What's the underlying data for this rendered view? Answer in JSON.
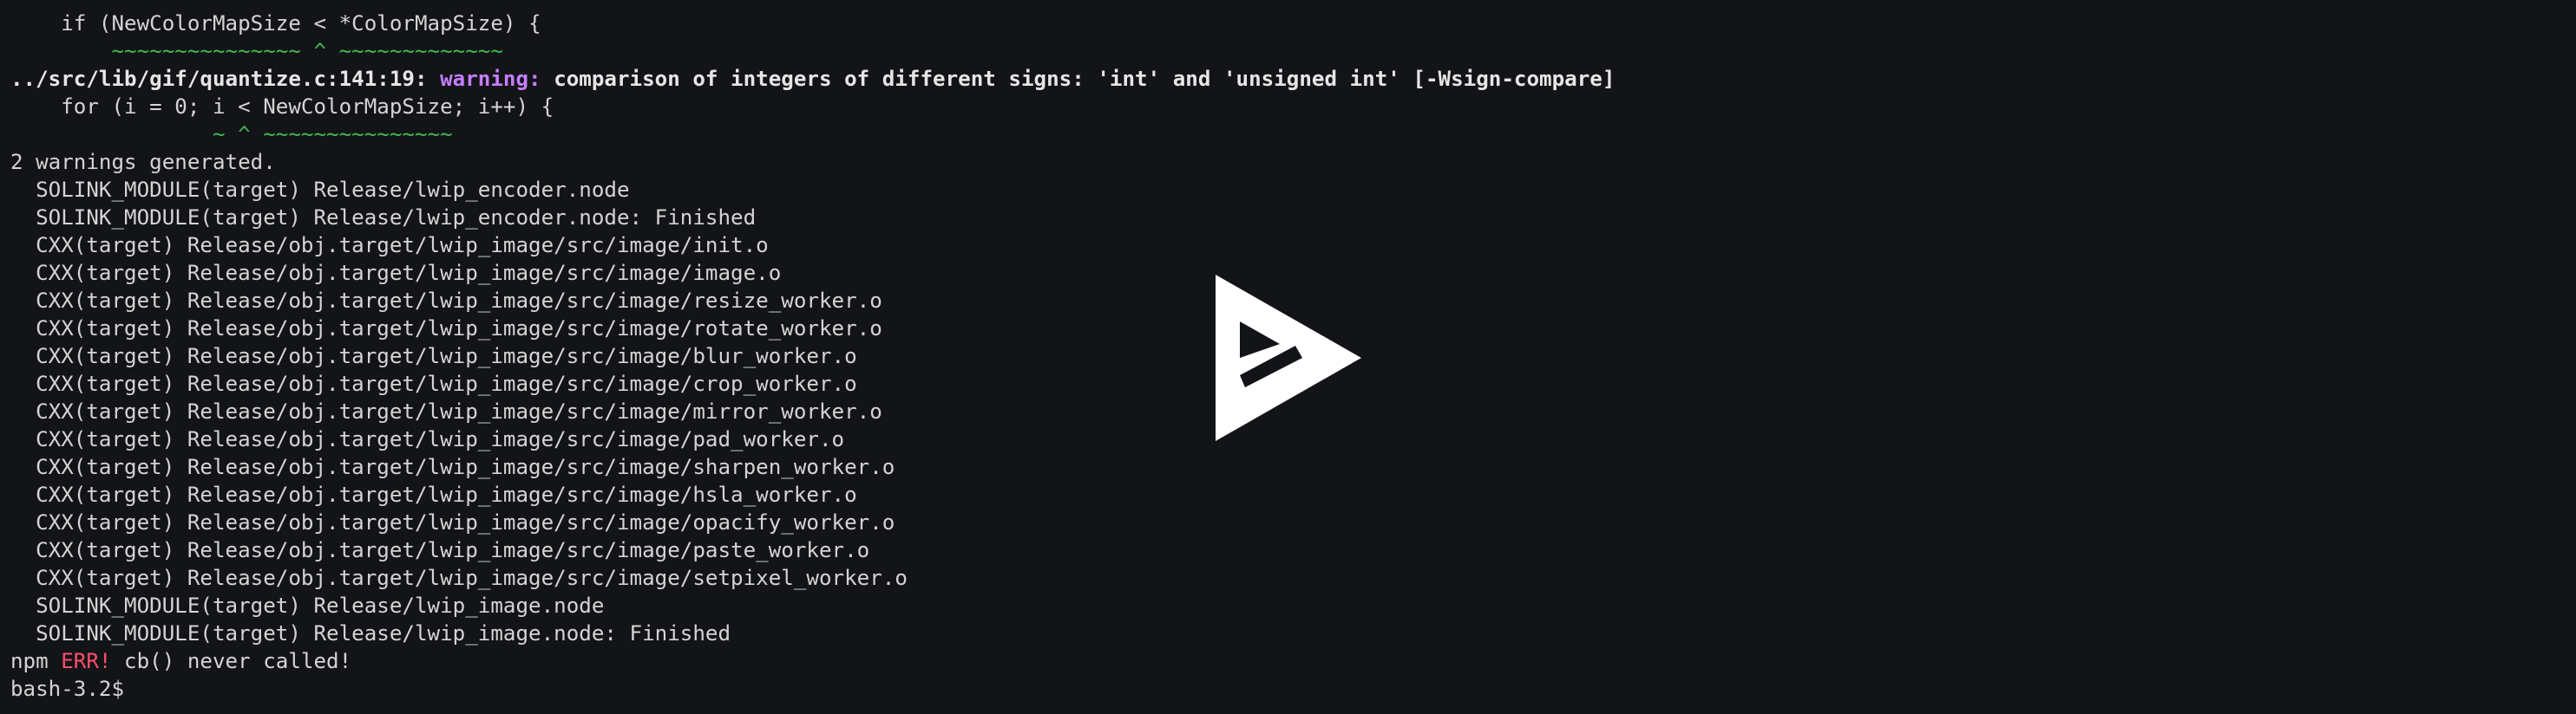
{
  "terminal": {
    "line_if": "    if (NewColorMapSize < *ColorMapSize) {",
    "line_if_marker": "        ~~~~~~~~~~~~~~~ ^ ~~~~~~~~~~~~~",
    "warning_location": "../src/lib/gif/quantize.c:141:19:",
    "warning_label": "warning:",
    "warning_message": "comparison of integers of different signs: 'int' and 'unsigned int' [-Wsign-compare]",
    "line_for": "    for (i = 0; i < NewColorMapSize; i++) {",
    "line_for_marker": "                ~ ^ ~~~~~~~~~~~~~~~",
    "warnings_generated": "2 warnings generated.",
    "build_lines": [
      "  SOLINK_MODULE(target) Release/lwip_encoder.node",
      "  SOLINK_MODULE(target) Release/lwip_encoder.node: Finished",
      "  CXX(target) Release/obj.target/lwip_image/src/image/init.o",
      "  CXX(target) Release/obj.target/lwip_image/src/image/image.o",
      "  CXX(target) Release/obj.target/lwip_image/src/image/resize_worker.o",
      "  CXX(target) Release/obj.target/lwip_image/src/image/rotate_worker.o",
      "  CXX(target) Release/obj.target/lwip_image/src/image/blur_worker.o",
      "  CXX(target) Release/obj.target/lwip_image/src/image/crop_worker.o",
      "  CXX(target) Release/obj.target/lwip_image/src/image/mirror_worker.o",
      "  CXX(target) Release/obj.target/lwip_image/src/image/pad_worker.o",
      "  CXX(target) Release/obj.target/lwip_image/src/image/sharpen_worker.o",
      "  CXX(target) Release/obj.target/lwip_image/src/image/hsla_worker.o",
      "  CXX(target) Release/obj.target/lwip_image/src/image/opacify_worker.o",
      "  CXX(target) Release/obj.target/lwip_image/src/image/paste_worker.o",
      "  CXX(target) Release/obj.target/lwip_image/src/image/setpixel_worker.o",
      "  SOLINK_MODULE(target) Release/lwip_image.node",
      "  SOLINK_MODULE(target) Release/lwip_image.node: Finished"
    ],
    "npm_prefix": "npm",
    "npm_err_label": "ERR!",
    "npm_err_message": " cb() never called!",
    "prompt": "bash-3.2$"
  },
  "overlay": {
    "icon": "asciinema-play-icon"
  },
  "colors": {
    "background": "#121417",
    "text": "#d4d4d4",
    "marker_green": "#3fb950",
    "warning_magenta": "#c77dff",
    "error_red": "#ff4d6d"
  }
}
